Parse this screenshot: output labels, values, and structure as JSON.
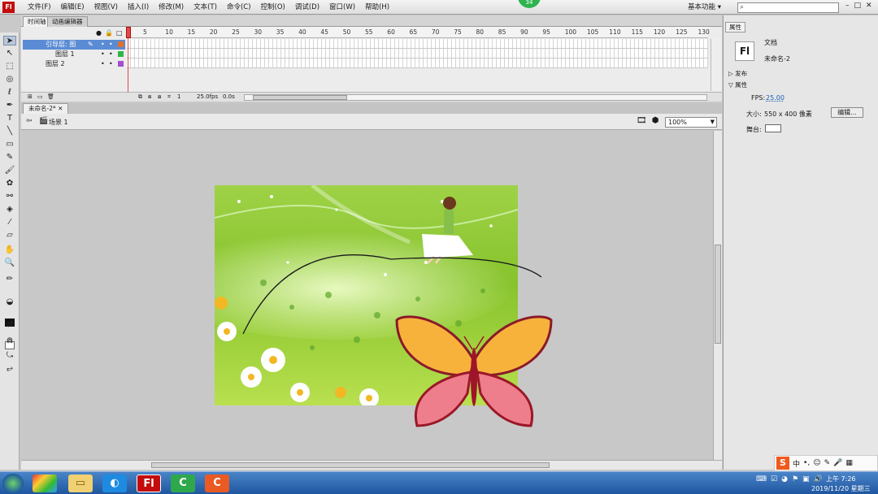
{
  "menubar": {
    "items": [
      "文件(F)",
      "编辑(E)",
      "视图(V)",
      "插入(I)",
      "修改(M)",
      "文本(T)",
      "命令(C)",
      "控制(O)",
      "调试(D)",
      "窗口(W)",
      "帮助(H)"
    ],
    "workspace": "基本功能",
    "badge": "34"
  },
  "timeline": {
    "tabs": [
      "时间轴",
      "动画编辑器"
    ],
    "ruler": [
      "5",
      "10",
      "15",
      "20",
      "25",
      "30",
      "35",
      "40",
      "45",
      "50",
      "55",
      "60",
      "65",
      "70",
      "75",
      "80",
      "85",
      "90",
      "95",
      "100",
      "105",
      "110",
      "115",
      "120",
      "125",
      "130"
    ],
    "layers": [
      {
        "name": "引导层: 图",
        "color": "#e0702a"
      },
      {
        "name": "图层 1",
        "color": "#2fb44a"
      },
      {
        "name": "图层 2",
        "color": "#a14fd0"
      }
    ],
    "status": {
      "frame": "1",
      "fps": "25.0fps",
      "time": "0.0s"
    }
  },
  "document": {
    "tab": "未命名-2*",
    "scene": "场景 1",
    "zoom": "100%"
  },
  "properties": {
    "tab": "属性",
    "kind": "文档",
    "name": "未命名-2",
    "sections": {
      "publish": "发布",
      "props": "属性"
    },
    "fps_label": "FPS:",
    "fps_value": "25.00",
    "size_label": "大小:",
    "size_value": "550 x 400 像素",
    "edit_button": "编辑...",
    "stage_label": "舞台:",
    "stage_color": "#ffffff"
  },
  "taskbar": {
    "time": "上午 7:26",
    "date": "2019/11/20 星期三"
  },
  "colors": {
    "accent": "#5b8bd4",
    "playhead": "#e04a4a"
  }
}
